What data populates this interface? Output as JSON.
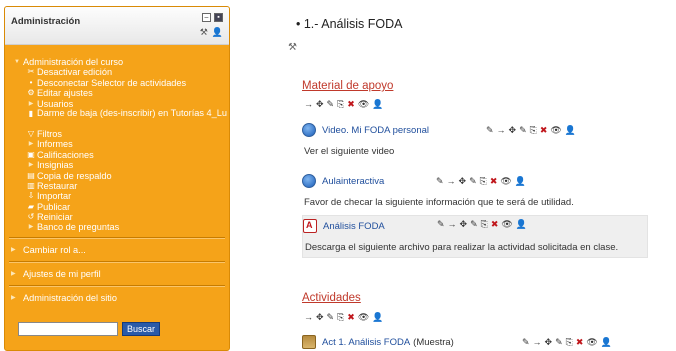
{
  "admin": {
    "title": "Administración",
    "course_admin_label": "Administración del curso",
    "items": [
      {
        "label": "Desactivar edición",
        "icon": "tools-icon"
      },
      {
        "label": "Desconectar Selector de actividades",
        "icon": "bullet-icon"
      },
      {
        "label": "Editar ajustes",
        "icon": "gear-icon"
      },
      {
        "label": "Usuarios",
        "icon": "expand-triangle-icon"
      },
      {
        "label": "Darme de baja (des-inscribir) en Tutorías 4_Lu",
        "icon": "unenrol-icon"
      },
      {
        "label": "Filtros",
        "icon": "filter-icon"
      },
      {
        "label": "Informes",
        "icon": "expand-triangle-icon"
      },
      {
        "label": "Calificaciones",
        "icon": "grades-icon"
      },
      {
        "label": "Insignias",
        "icon": "expand-triangle-icon"
      },
      {
        "label": "Copia de respaldo",
        "icon": "backup-icon"
      },
      {
        "label": "Restaurar",
        "icon": "restore-icon"
      },
      {
        "label": "Importar",
        "icon": "import-icon"
      },
      {
        "label": "Publicar",
        "icon": "publish-icon"
      },
      {
        "label": "Reiniciar",
        "icon": "reset-icon"
      },
      {
        "label": "Banco de preguntas",
        "icon": "expand-triangle-icon"
      }
    ],
    "links": [
      {
        "label": "Cambiar rol a..."
      },
      {
        "label": "Ajustes de mi perfil"
      },
      {
        "label": "Administración del sitio"
      }
    ],
    "search_value": "",
    "search_button": "Buscar"
  },
  "content": {
    "topic_title": "1.- Análisis FODA",
    "sections": [
      {
        "title": "Material de apoyo"
      },
      {
        "title": "Actividades"
      }
    ],
    "activities": [
      {
        "name": "Video. Mi FODA personal",
        "desc": "Ver el siguiente video",
        "icon": "url-icon"
      },
      {
        "name": "Aulainteractiva",
        "desc": "Favor de checar la siguiente información que te será de utilidad.",
        "icon": "url-icon"
      },
      {
        "name": "Análisis FODA",
        "desc": "Descarga el siguiente archivo para realizar la actividad solicitada en clase.",
        "icon": "pdf-icon"
      },
      {
        "name": "Act 1. Análisis FODA",
        "suffix": "(Muestra)",
        "icon": "assignment-icon"
      }
    ]
  },
  "colors": {
    "admin_bg": "#f5a319",
    "section_title": "#c0392b",
    "link": "#1f4e9c"
  }
}
